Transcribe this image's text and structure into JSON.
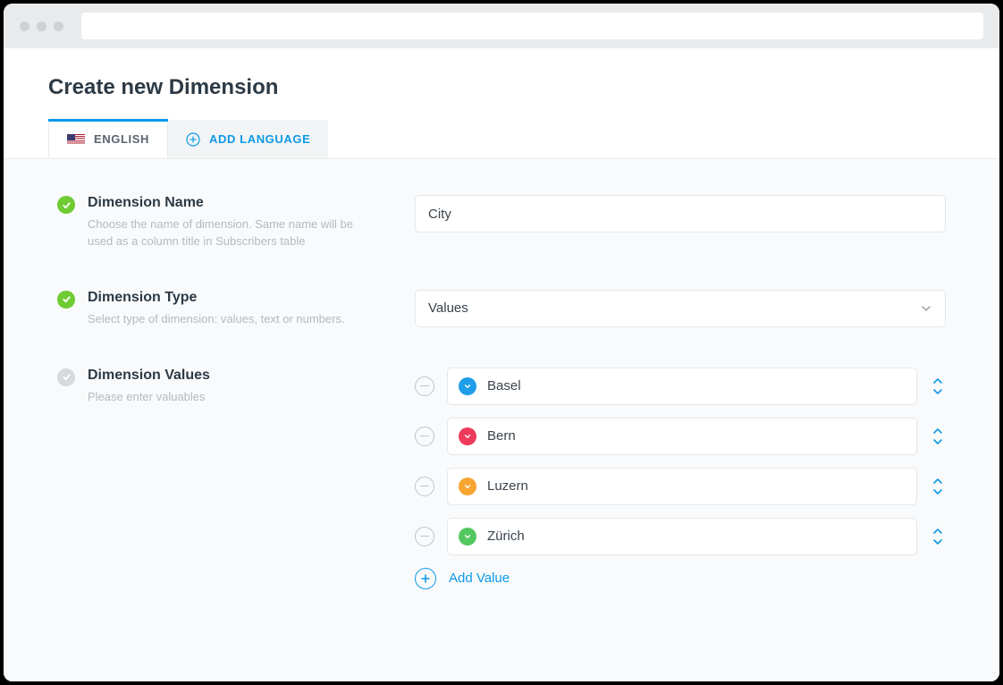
{
  "page": {
    "title": "Create new Dimension"
  },
  "tabs": {
    "active": "ENGLISH",
    "add_label": "ADD LANGUAGE"
  },
  "fields": {
    "name": {
      "label": "Dimension Name",
      "help": "Choose the name of dimension. Same name will be used as a column title in Subscribers table",
      "value": "City",
      "valid": true
    },
    "type": {
      "label": "Dimension Type",
      "help": "Select type of dimension: values, text or numbers.",
      "selected": "Values",
      "valid": true
    },
    "values": {
      "label": "Dimension Values",
      "help": "Please enter valuables",
      "valid": false,
      "items": [
        {
          "name": "Basel",
          "color": "#1e9de8"
        },
        {
          "name": "Bern",
          "color": "#ee3a5b"
        },
        {
          "name": "Luzern",
          "color": "#f7a531"
        },
        {
          "name": "Zürich",
          "color": "#54c860"
        }
      ],
      "add_label": "Add Value"
    }
  }
}
